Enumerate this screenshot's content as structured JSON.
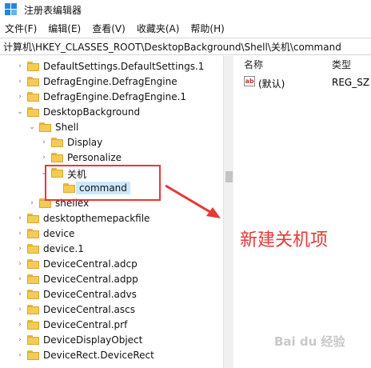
{
  "window": {
    "title": "注册表编辑器"
  },
  "menu": [
    "文件(F)",
    "编辑(E)",
    "查看(V)",
    "收藏夹(A)",
    "帮助(H)"
  ],
  "address": "计算机\\HKEY_CLASSES_ROOT\\DesktopBackground\\Shell\\关机\\command",
  "tree": [
    {
      "label": "DefaultSettings.DefaultSettings.1",
      "arrow": "›"
    },
    {
      "label": "DefragEngine.DefragEngine",
      "arrow": "›"
    },
    {
      "label": "DefragEngine.DefragEngine.1",
      "arrow": "›"
    },
    {
      "label": "DesktopBackground",
      "arrow": "⌄"
    },
    {
      "label": "Shell",
      "arrow": "⌄"
    },
    {
      "label": "Display",
      "arrow": "›"
    },
    {
      "label": "Personalize",
      "arrow": "›"
    },
    {
      "label": "关机",
      "arrow": "⌄"
    },
    {
      "label": "command",
      "arrow": ""
    },
    {
      "label": "shellex",
      "arrow": "›"
    },
    {
      "label": "desktopthemepackfile",
      "arrow": "›"
    },
    {
      "label": "device",
      "arrow": "›"
    },
    {
      "label": "device.1",
      "arrow": "›"
    },
    {
      "label": "DeviceCentral.adcp",
      "arrow": "›"
    },
    {
      "label": "DeviceCentral.adpp",
      "arrow": "›"
    },
    {
      "label": "DeviceCentral.advs",
      "arrow": "›"
    },
    {
      "label": "DeviceCentral.ascs",
      "arrow": "›"
    },
    {
      "label": "DeviceCentral.prf",
      "arrow": "›"
    },
    {
      "label": "DeviceDisplayObject",
      "arrow": "›"
    },
    {
      "label": "DeviceRect.DeviceRect",
      "arrow": "›"
    }
  ],
  "list": {
    "columns": [
      "名称",
      "类型"
    ],
    "rows": [
      {
        "name": "(默认)",
        "type": "REG_SZ",
        "icon": "ab"
      }
    ]
  },
  "annotation": "新建关机项",
  "watermark": "Bai du 经验",
  "colors": {
    "annotation": "#e53935",
    "selection": "#cce8ff",
    "folder": "#f5cb57"
  }
}
